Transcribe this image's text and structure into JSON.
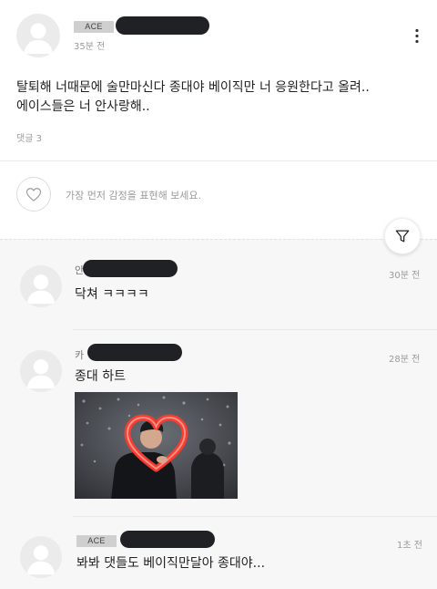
{
  "post": {
    "badge": "ACE",
    "time": "35분 전",
    "content_line1": "탈퇴해 너때문에 술만마신다 종대야 베이직만 너 응원한다고 올려..",
    "content_line2": "에이스들은 너 안사랑해..",
    "comment_count": "댓글 3",
    "reaction_placeholder": "가장 먼저 감정을 표현해 보세요."
  },
  "icons": {
    "more": "more-vertical-icon",
    "heart": "heart-outline-icon",
    "filter": "filter-funnel-icon",
    "avatar": "default-user-avatar-icon"
  },
  "comments": [
    {
      "name_prefix": "안",
      "time": "30분 전",
      "text": "닥쳐 ㅋㅋㅋㅋ"
    },
    {
      "name_prefix": "카",
      "time": "28분 전",
      "text": "종대 하트",
      "image": "person-holding-heart-balloon-photo"
    },
    {
      "badge": "ACE",
      "time": "1초 전",
      "text": "봐봐 댓들도 베이직만달아 종대야..."
    }
  ],
  "colors": {
    "background": "#ffffff",
    "comment_area": "#f7f7f8",
    "badge_bg": "#cfcfcf",
    "redaction": "#202124",
    "heart_balloon": "#ff3b2e"
  }
}
